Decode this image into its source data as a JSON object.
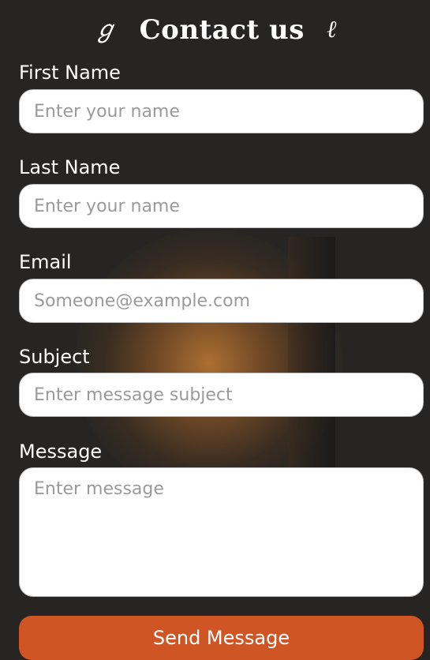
{
  "header": {
    "title": "Contact us",
    "ornament_left": "ℊ",
    "ornament_right": "ℓ"
  },
  "form": {
    "first_name": {
      "label": "First Name",
      "placeholder": "Enter your name"
    },
    "last_name": {
      "label": "Last Name",
      "placeholder": "Enter your name"
    },
    "email": {
      "label": "Email",
      "placeholder": "Someone@example.com"
    },
    "subject": {
      "label": "Subject",
      "placeholder": "Enter message subject"
    },
    "message": {
      "label": "Message",
      "placeholder": "Enter message"
    },
    "submit_label": "Send Message"
  },
  "colors": {
    "background": "#262523",
    "accent": "#d05524",
    "glow": "#c47c34",
    "field_bg": "#ffffff",
    "placeholder": "#9a9a9a"
  }
}
